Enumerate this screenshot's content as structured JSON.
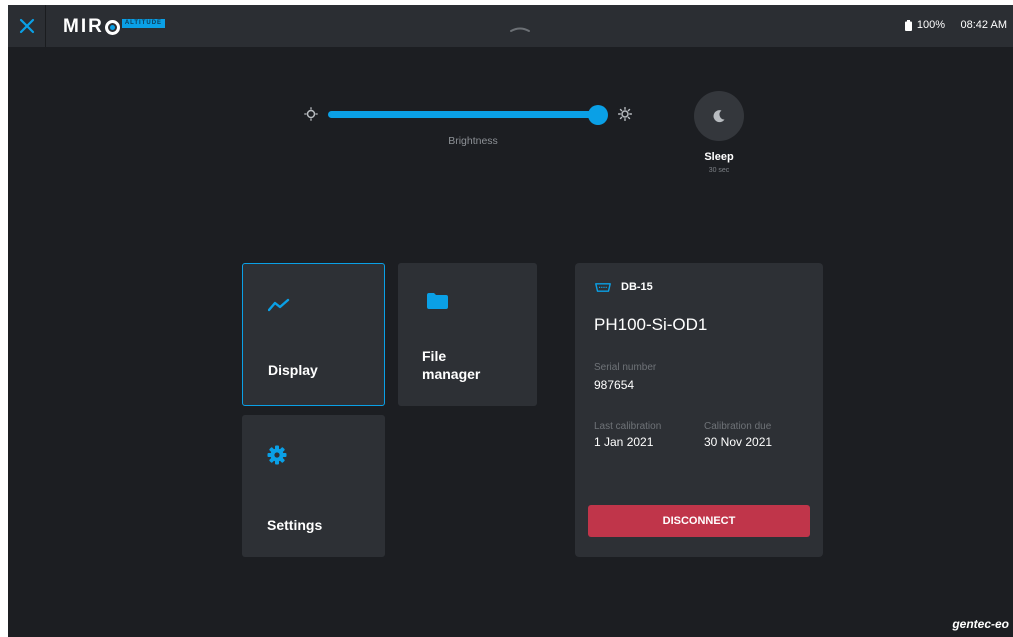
{
  "topbar": {
    "logo_text": "MIR",
    "logo_badge": "ALTITUDE",
    "battery": "100%",
    "time": "08:42 AM"
  },
  "brightness": {
    "label": "Brightness",
    "level": 0.97
  },
  "sleep": {
    "label": "Sleep",
    "sub": "30 sec"
  },
  "tiles": {
    "display": "Display",
    "file_manager_line1": "File",
    "file_manager_line2": "manager",
    "settings": "Settings"
  },
  "device": {
    "connector": "DB-15",
    "model": "PH100-Si-OD1",
    "serial_label": "Serial number",
    "serial_value": "987654",
    "last_cal_label": "Last calibration",
    "last_cal_value": "1 Jan 2021",
    "cal_due_label": "Calibration due",
    "cal_due_value": "30 Nov 2021",
    "disconnect_label": "DISCONNECT"
  },
  "brand": "gentec-eo",
  "colors": {
    "accent": "#0aa0e6",
    "danger": "#c0354a",
    "background": "#1c1e22",
    "tile": "#2d3035"
  }
}
